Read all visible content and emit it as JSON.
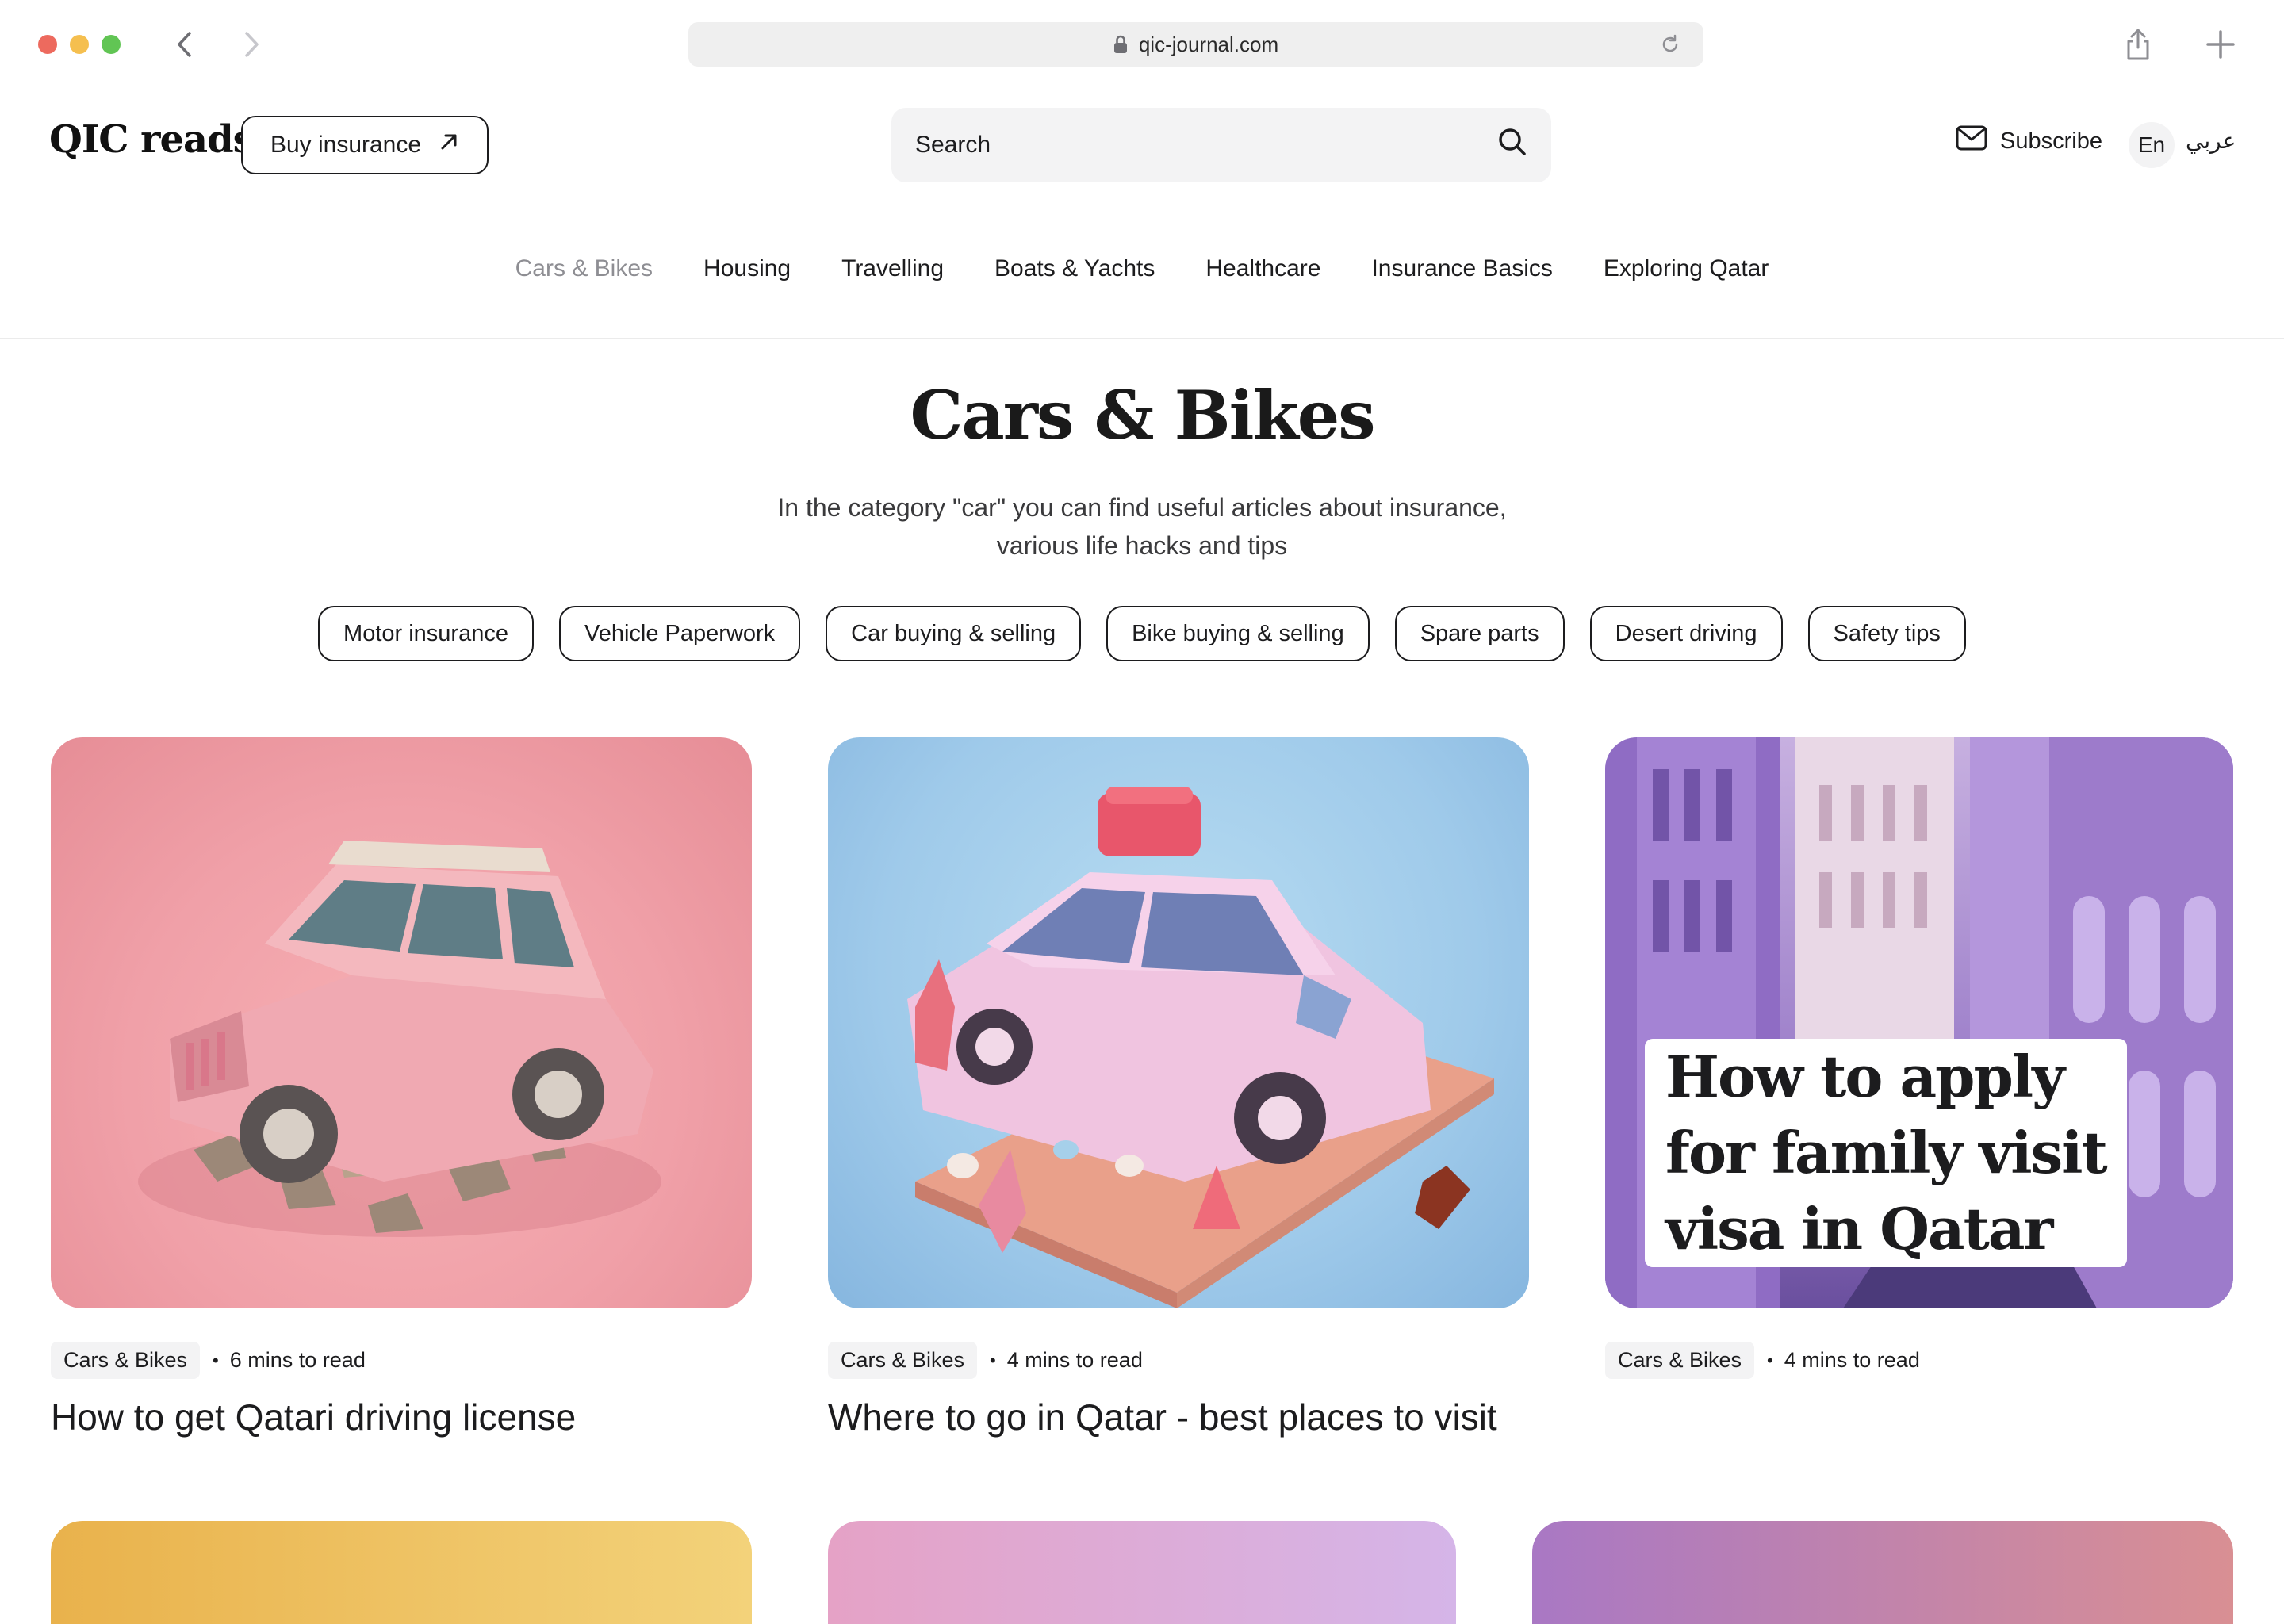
{
  "browser": {
    "url": "qic-journal.com"
  },
  "header": {
    "brand": "QIC reads",
    "buy_label": "Buy insurance",
    "search_placeholder": "Search",
    "subscribe_label": "Subscribe",
    "lang_en": "En",
    "lang_ar": "عربي"
  },
  "nav": {
    "items": [
      {
        "label": "Cars & Bikes",
        "active": true
      },
      {
        "label": "Housing"
      },
      {
        "label": "Travelling"
      },
      {
        "label": "Boats & Yachts"
      },
      {
        "label": "Healthcare"
      },
      {
        "label": "Insurance Basics"
      },
      {
        "label": "Exploring Qatar"
      }
    ]
  },
  "hero": {
    "title": "Cars & Bikes",
    "description": "In the category \"car\" you can find useful articles about insurance, various life hacks and tips"
  },
  "tags": [
    "Motor insurance",
    "Vehicle Paperwork",
    "Car buying & selling",
    "Bike buying & selling",
    "Spare parts",
    "Desert driving",
    "Safety tips"
  ],
  "articles": [
    {
      "category": "Cars & Bikes",
      "read_time": "6 mins to read",
      "title": "How to get Qatari driving license",
      "image": "pink-suv-illustration"
    },
    {
      "category": "Cars & Bikes",
      "read_time": "4 mins to read",
      "title": "Where to go in Qatar - best places to visit",
      "image": "pink-car-illustration"
    },
    {
      "category": "Cars & Bikes",
      "read_time": "4 mins to read",
      "title": "",
      "image": "purple-street-illustration",
      "overlay_lines": [
        "How to apply",
        "for family visit",
        "visa in Qatar"
      ]
    }
  ],
  "colors": {
    "accent": "#1c1c1e",
    "muted": "#8e8e93",
    "chip_bg": "#f3f3f4"
  }
}
